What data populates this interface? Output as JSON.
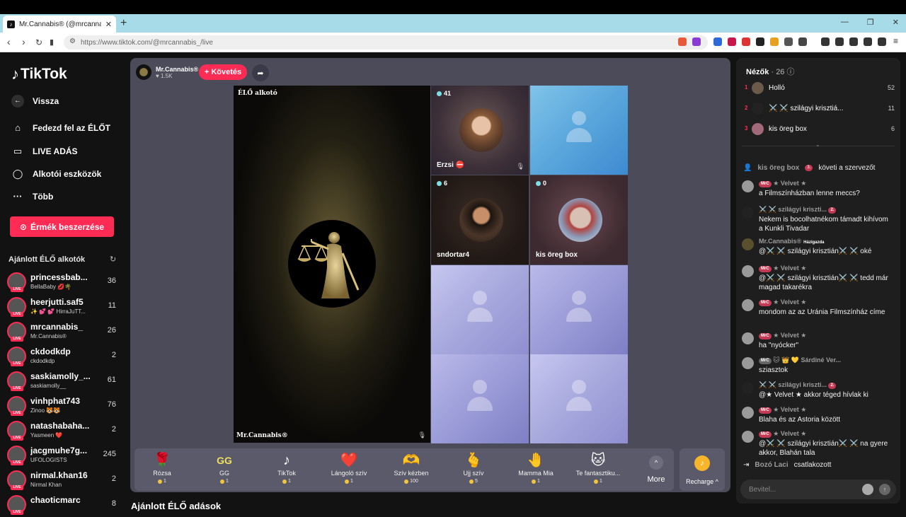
{
  "browser": {
    "tab_title": "Mr.Cannabis® (@mrcannabis_) | TikTok",
    "url": "https://www.tiktok.com/@mrcannabis_/live",
    "tab_close": "✕",
    "new_tab": "+",
    "win_min": "—",
    "win_max": "❐",
    "win_close": "✕"
  },
  "sidebar": {
    "logo": "TikTok",
    "back": "Vissza",
    "nav": [
      "Fedezd fel az ÉLŐT",
      "LIVE ADÁS",
      "Alkotói eszközök",
      "Több"
    ],
    "coins_button": "Érmék beszerzése",
    "recommended_title": "Ajánlott ÉLŐ alkotók",
    "creators": [
      {
        "name": "princessbab...",
        "sub": "BellaBaby 💋🌴",
        "count": "36"
      },
      {
        "name": "heerjutti.saf5",
        "sub": "✨ 💕 💕 HirraJuTT...",
        "count": "11"
      },
      {
        "name": "mrcannabis_",
        "sub": "Mr.Cannabis®",
        "count": "26"
      },
      {
        "name": "ckdodkdp",
        "sub": "ckdodkdp",
        "count": "2"
      },
      {
        "name": "saskiamolly_...",
        "sub": "saskiamolly__",
        "count": "61"
      },
      {
        "name": "vinhphat743",
        "sub": "Zinoo 🐯🐯",
        "count": "76"
      },
      {
        "name": "natashabaha...",
        "sub": "Yasmeen ❤️",
        "count": "2"
      },
      {
        "name": "jacgmuhe7g...",
        "sub": "UFOLOGISTS",
        "count": "245"
      },
      {
        "name": "nirmal.khan16",
        "sub": "Nirmal Khan",
        "count": "2"
      },
      {
        "name": "chaoticmarc",
        "sub": "",
        "count": "8"
      }
    ],
    "live_tag": "LIVE"
  },
  "stage": {
    "host_name": "Mr.Cannabis®",
    "host_likes": "♥ 1.5K",
    "follow": "+ Követés",
    "main_label": "ÉLŐ alkotó",
    "main_host": "Mr.Cannabis®",
    "tiles": [
      {
        "count": "41",
        "name": "Erzsi ⛔"
      },
      {
        "count": "",
        "name": ""
      },
      {
        "count": "6",
        "name": "sndortar4"
      },
      {
        "count": "0",
        "name": "kis öreg box"
      }
    ],
    "suggested_title": "Ajánlott ÉLŐ adások"
  },
  "gifts": [
    {
      "icon": "🌹",
      "name": "Rózsa",
      "price": "1"
    },
    {
      "icon": "GG",
      "name": "GG",
      "price": "1"
    },
    {
      "icon": "♪",
      "name": "TikTok",
      "price": "1"
    },
    {
      "icon": "❤️",
      "name": "Lángoló szív",
      "price": "1"
    },
    {
      "icon": "🫶",
      "name": "Szív kézben",
      "price": "100"
    },
    {
      "icon": "🫰",
      "name": "Ujj szív",
      "price": "5"
    },
    {
      "icon": "🤚",
      "name": "Mamma Mia",
      "price": "1"
    },
    {
      "icon": "🐱",
      "name": "Te fantasztiku...",
      "price": "1"
    }
  ],
  "gift_more": "More",
  "gift_more_icon": "^",
  "recharge": "Recharge ^",
  "recharge_icon": "♪",
  "viewers": {
    "title": "Nézők",
    "count": "· 26",
    "top": [
      {
        "rank": "1",
        "name": "Holló",
        "score": "52"
      },
      {
        "rank": "2",
        "name": "⚔️ ⚔️ szilágyi krisztiá...",
        "score": "11"
      },
      {
        "rank": "3",
        "name": "kis öreg box",
        "score": "6"
      }
    ]
  },
  "chat": {
    "follow_event": {
      "user": "kis öreg box",
      "badge": "3.",
      "text": "követi a szervezőt"
    },
    "messages": [
      {
        "badge": "MrC",
        "user": "★ Velvet ★",
        "text": "a Filmszínházban lenne meccs?"
      },
      {
        "badge": "2.",
        "user": "⚔️ ⚔️ szilágyi kriszti...",
        "text": "Nekem is bocolhatnékom támadt kihívom a Kunkli Tivadar"
      },
      {
        "badge": "Házigazda",
        "user": "Mr.Cannabis®",
        "text": "@⚔️ ⚔️ szilágyi krisztián⚔️ ⚔️ oké"
      },
      {
        "badge": "MrC",
        "user": "★ Velvet ★",
        "text": "@⚔️ ⚔️ szilágyi krisztián⚔️ ⚔️ tedd már magad takarékra"
      },
      {
        "badge": "MrC",
        "user": "★ Velvet ★",
        "text": "mondom az az Uránia Filmszínház címe"
      },
      {
        "badge": "MrC",
        "user": "★ Velvet ★",
        "text": "ha \"nyócker\""
      },
      {
        "badge": "MrC",
        "user": "🐱 👑 💛 Sárdiné Ver...",
        "text": "sziasztok"
      },
      {
        "badge": "2.",
        "user": "⚔️ ⚔️ szilágyi kriszti...",
        "text": "@★ Velvet ★ akkor téged hívlak ki"
      },
      {
        "badge": "MrC",
        "user": "★ Velvet ★",
        "text": "Blaha és az Astoria között"
      },
      {
        "badge": "MrC",
        "user": "★ Velvet ★",
        "text": "@⚔️ ⚔️ szilágyi krisztián⚔️ ⚔️ na gyere akkor, Blahán tala"
      }
    ],
    "join_event": {
      "user": "Bozó Laci",
      "text": "csatlakozott"
    },
    "input_placeholder": "Bevitel..."
  },
  "icons": {
    "back": "arrow-left-icon",
    "explore": "compass-icon",
    "live": "camera-icon",
    "tools": "lightbulb-icon",
    "more": "more-dots-icon",
    "share": "share-arrow-icon",
    "mic_off": "mic-off-icon"
  },
  "colors": {
    "accent": "#fe2c55",
    "background": "#121212",
    "stage": "#4b4b5a",
    "coin": "#f7c53b"
  }
}
